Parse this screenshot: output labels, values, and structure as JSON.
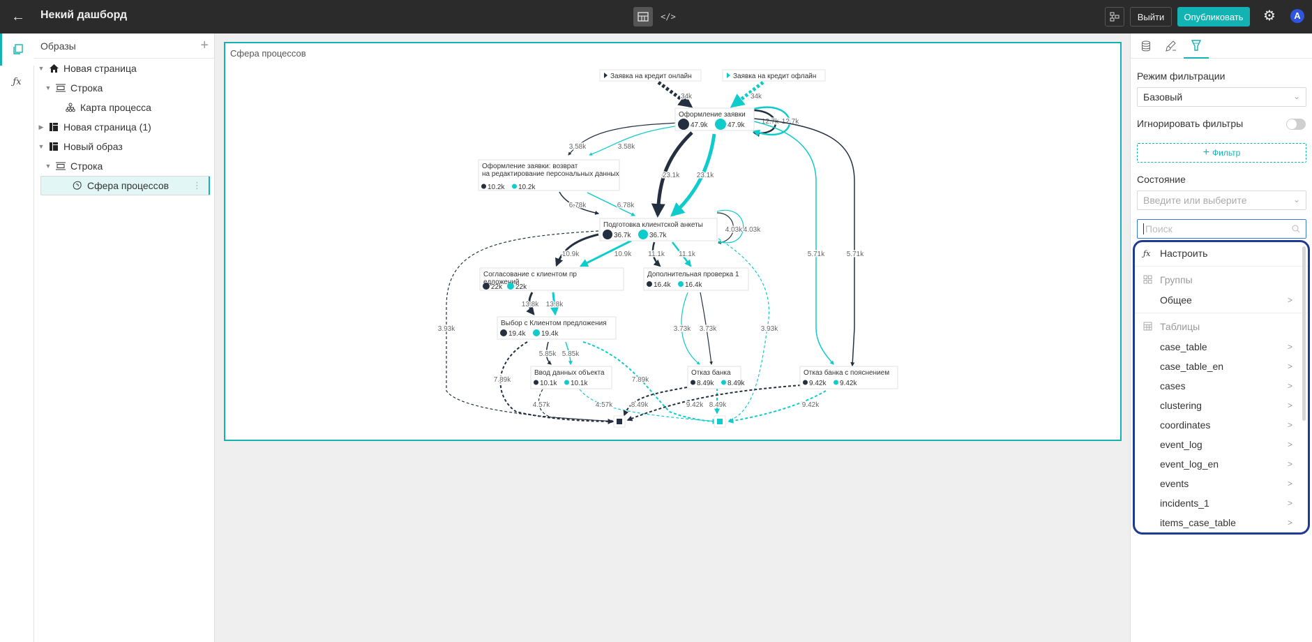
{
  "header": {
    "title": "Некий дашборд",
    "exit_label": "Выйти",
    "publish_label": "Опубликовать",
    "avatar_letter": "A",
    "icons": [
      "back-arrow-icon",
      "layout-icon",
      "code-icon",
      "hierarchy-icon",
      "gear-icon"
    ]
  },
  "tree": {
    "title": "Образы",
    "items": [
      {
        "label": "Новая страница",
        "icon": "home-icon"
      },
      {
        "label": "Строка",
        "icon": "row-icon"
      },
      {
        "label": "Карта процесса",
        "icon": "process-map-icon"
      },
      {
        "label": "Новая страница (1)",
        "icon": "page-icon"
      },
      {
        "label": "Новый образ",
        "icon": "page-icon"
      },
      {
        "label": "Строка",
        "icon": "row-icon"
      },
      {
        "label": "Сфера процессов",
        "icon": "sphere-icon"
      }
    ]
  },
  "canvas": {
    "widget_title": "Сфера процессов"
  },
  "right_panel": {
    "tabs": [
      "data-icon",
      "style-icon",
      "filter-icon"
    ],
    "filter_mode_label": "Режим фильтрации",
    "filter_mode_value": "Базовый",
    "ignore_filters_label": "Игнорировать фильтры",
    "ignore_filters_on": false,
    "add_filter_label": "Фильтр",
    "state_label": "Состояние",
    "state_placeholder": "Введите или выберите",
    "search_placeholder": "Поиск",
    "dropdown": {
      "configure_label": "Настроить",
      "groups_label": "Группы",
      "groups": [
        "Общее"
      ],
      "tables_label": "Таблицы",
      "tables": [
        "case_table",
        "case_table_en",
        "cases",
        "clustering",
        "coordinates",
        "event_log",
        "event_log_en",
        "events",
        "incidents_1",
        "items_case_table"
      ]
    }
  },
  "process_map": {
    "colors": {
      "dark": "#24303f",
      "teal": "#0fcbcb"
    },
    "starts": [
      {
        "id": "s1",
        "label": "Заявка на кредит онлайн",
        "color": "dark"
      },
      {
        "id": "s2",
        "label": "Заявка на кредит офлайн",
        "color": "teal"
      }
    ],
    "nodes": [
      {
        "id": "n1",
        "label": "Оформление заявки",
        "dark": "47.9k",
        "teal": "47.9k"
      },
      {
        "id": "n2",
        "label": "Оформление заявки: возврат на редактирование персональных данных",
        "dark": "10.2k",
        "teal": "10.2k"
      },
      {
        "id": "n3",
        "label": "Подготовка клиентской анкеты",
        "dark": "36.7k",
        "teal": "36.7k"
      },
      {
        "id": "n4",
        "label": "Согласование с клиентом предложений",
        "dark": "22k",
        "teal": "22k"
      },
      {
        "id": "n5",
        "label": "Дополнительная проверка 1",
        "dark": "16.4k",
        "teal": "16.4k"
      },
      {
        "id": "n6",
        "label": "Выбор с Клиентом предложения",
        "dark": "19.4k",
        "teal": "19.4k"
      },
      {
        "id": "n7",
        "label": "Ввод данных объекта",
        "dark": "10.1k",
        "teal": "10.1k"
      },
      {
        "id": "n8",
        "label": "Отказ банка",
        "dark": "8.49k",
        "teal": "8.49k"
      },
      {
        "id": "n9",
        "label": "Отказ банка с пояснением",
        "dark": "9.42k",
        "teal": "9.42k"
      }
    ],
    "edges": [
      {
        "from": "s1",
        "to": "n1",
        "dark": "34k"
      },
      {
        "from": "s2",
        "to": "n1",
        "teal": "34k"
      },
      {
        "from": "n1",
        "to": "n1",
        "dark": "12.7k",
        "teal": "12.7k"
      },
      {
        "from": "n1",
        "to": "n2",
        "dark": "3.58k",
        "teal": "3.58k"
      },
      {
        "from": "n1",
        "to": "n3",
        "dark": "23.1k",
        "teal": "23.1k"
      },
      {
        "from": "n1",
        "to": "n9",
        "dark": "5.71k",
        "teal": "5.71k"
      },
      {
        "from": "n2",
        "to": "n3",
        "dark": "6.78k",
        "teal": "6.78k"
      },
      {
        "from": "n3",
        "to": "n3",
        "dark": "4.03k",
        "teal": "4.03k"
      },
      {
        "from": "n3",
        "to": "n4",
        "dark": "10.9k",
        "teal": "10.9k"
      },
      {
        "from": "n3",
        "to": "n5",
        "dark": "11.1k",
        "teal": "11.1k"
      },
      {
        "from": "n3",
        "to": "end",
        "dark": "3.93k",
        "teal": "3.93k"
      },
      {
        "from": "n4",
        "to": "n6",
        "dark": "13.8k",
        "teal": "13.8k"
      },
      {
        "from": "n5",
        "to": "n8",
        "dark": "3.73k",
        "teal": "3.73k"
      },
      {
        "from": "n6",
        "to": "n7",
        "dark": "5.85k",
        "teal": "5.85k"
      },
      {
        "from": "n6",
        "to": "end",
        "dark": "7.89k",
        "teal": "7.89k"
      },
      {
        "from": "n7",
        "to": "end",
        "dark": "4.57k",
        "teal": "4.57k"
      },
      {
        "from": "n8",
        "to": "end",
        "dark": "8.49k",
        "teal": "8.49k"
      },
      {
        "from": "n9",
        "to": "end",
        "dark": "9.42k",
        "teal": "9.42k"
      }
    ]
  }
}
